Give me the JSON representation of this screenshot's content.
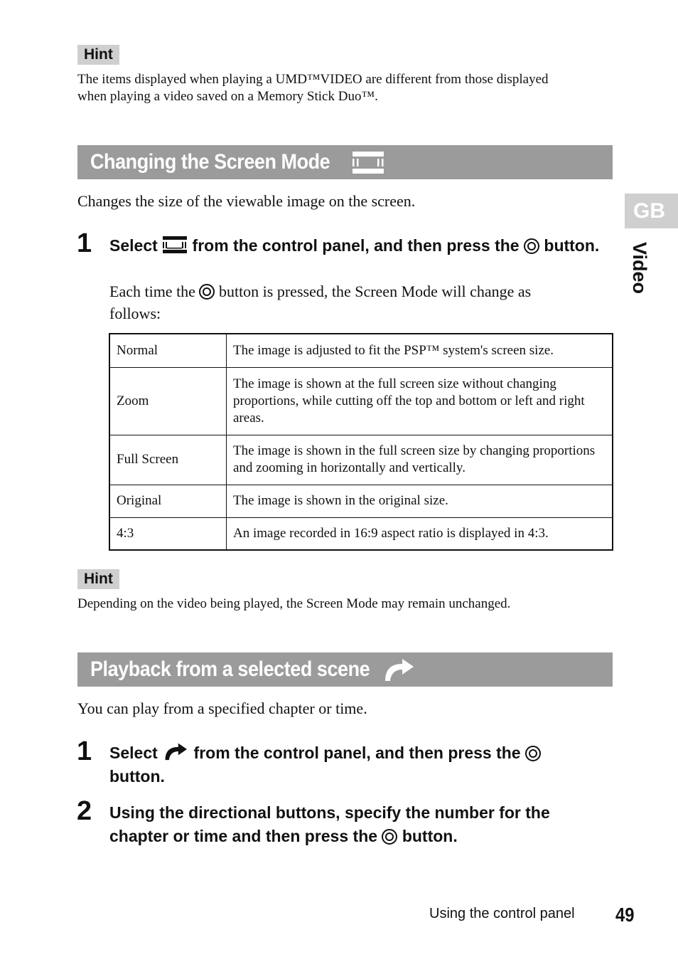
{
  "hint1": {
    "label": "Hint",
    "text_line1": "The items displayed when playing a UMD™VIDEO are different from those displayed",
    "text_line2": "when playing a video saved on a Memory Stick Duo™."
  },
  "side_tab": {
    "code": "GB",
    "section": "Video"
  },
  "section1": {
    "title": "Changing the Screen Mode",
    "icon": "screen-mode-icon",
    "intro": "Changes the size of the viewable image on the screen.",
    "step1": {
      "number": "1",
      "text_before_icon": "Select",
      "text_after_icon": "from the control panel, and then press the",
      "text_end": "button.",
      "note_before": "Each time the",
      "note_after": "button is pressed, the Screen Mode will change as",
      "note_end": "follows:"
    },
    "modes_table": [
      {
        "mode": "Normal",
        "description": "The image is adjusted to fit the PSP™ system's screen size."
      },
      {
        "mode": "Zoom",
        "description": "The image is shown at the full screen size without changing proportions, while cutting off the top and bottom or left and right areas."
      },
      {
        "mode": "Full Screen",
        "description": "The image is shown in the full screen size by changing proportions and zooming in horizontally and vertically."
      },
      {
        "mode": "Original",
        "description": "The image is shown in the original size."
      },
      {
        "mode": "4:3",
        "description": "An image recorded in 16:9 aspect ratio is displayed in 4:3."
      }
    ]
  },
  "hint2": {
    "label": "Hint",
    "text": "Depending on the video being played, the Screen Mode may remain unchanged."
  },
  "section2": {
    "title": "Playback from a selected scene",
    "icon": "curved-arrow-icon",
    "intro": "You can play from a specified chapter or time.",
    "step1": {
      "number": "1",
      "text_before_icon": "Select",
      "text_after_icon": "from the control panel, and then press the",
      "text_end": "button."
    },
    "step2": {
      "number": "2",
      "line1": "Using the directional buttons, specify the number for the",
      "line2_before": "chapter or time and then press the",
      "line2_after": "button."
    }
  },
  "footer": {
    "label": "Using the control panel",
    "page_number": "49"
  }
}
